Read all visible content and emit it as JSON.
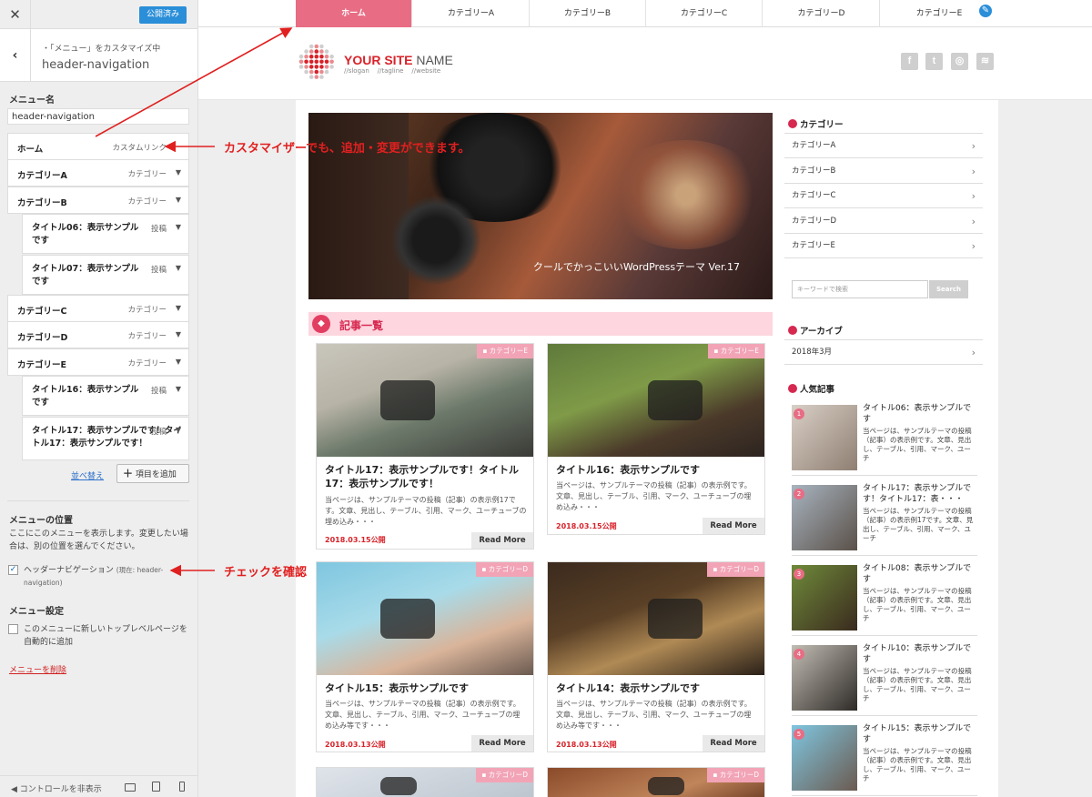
{
  "customizer": {
    "close_icon": "close-icon",
    "publish_label": "公開済み",
    "back_icon": "chevron-left-icon",
    "sub_title": "・「メニュー」をカスタマイズ中",
    "title": "header-navigation",
    "menu_name_label": "メニュー名",
    "menu_name_value": "header-navigation",
    "items": [
      {
        "title": "ホーム",
        "kind": "カスタムリンク",
        "level": 0
      },
      {
        "title": "カテゴリーA",
        "kind": "カテゴリー",
        "level": 0
      },
      {
        "title": "カテゴリーB",
        "kind": "カテゴリー",
        "level": 0
      },
      {
        "title": "タイトル06：表示サンプルです",
        "kind": "投稿",
        "level": 1
      },
      {
        "title": "タイトル07：表示サンプルです",
        "kind": "投稿",
        "level": 1
      },
      {
        "title": "カテゴリーC",
        "kind": "カテゴリー",
        "level": 0
      },
      {
        "title": "カテゴリーD",
        "kind": "カテゴリー",
        "level": 0
      },
      {
        "title": "カテゴリーE",
        "kind": "カテゴリー",
        "level": 0
      },
      {
        "title": "タイトル16：表示サンプルです",
        "kind": "投稿",
        "level": 1
      },
      {
        "title": "タイトル17：表示サンプルです！タイトル17：表示サンプルです！",
        "kind": "投稿",
        "level": 1
      }
    ],
    "reorder_label": "並べ替え",
    "add_items_label": "項目を追加",
    "location_heading": "メニューの位置",
    "location_desc": "ここにこのメニューを表示します。変更したい場合は、別の位置を選んでください。",
    "location_option": "ヘッダーナビゲーション",
    "location_option_note": "(現在: header-navigation)",
    "location_checked": true,
    "settings_heading": "メニュー設定",
    "auto_add_label": "このメニューに新しいトップレベルページを自動的に追加",
    "auto_add_checked": false,
    "delete_label": "メニューを削除",
    "hide_controls_label": "コントロールを非表示"
  },
  "preview": {
    "nav": [
      "ホーム",
      "カテゴリーA",
      "カテゴリーB",
      "カテゴリーC",
      "カテゴリーD",
      "カテゴリーE"
    ],
    "nav_active": 0,
    "site_name_bold": "YOUR SITE",
    "site_name_rest": " NAME",
    "site_tags": "//slogan    //tagline    //website",
    "social_icons": [
      "facebook-icon",
      "twitter-icon",
      "instagram-icon",
      "rss-icon"
    ],
    "hero_caption": "クールでかっこいいWordPressテーマ Ver.17",
    "section_title": "記事一覧",
    "cards": [
      {
        "category": "カテゴリーE",
        "title": "タイトル17：表示サンプルです！タイトル17：表示サンプルです！",
        "excerpt": "当ページは、サンプルテーマの投稿（記事）の表示例17です。文章、見出し、テーブル、引用、マーク、ユーチューブの埋め込み・・・",
        "date": "2018.03.15公開",
        "more": "Read More"
      },
      {
        "category": "カテゴリーE",
        "title": "タイトル16：表示サンプルです",
        "excerpt": "当ページは、サンプルテーマの投稿（記事）の表示例です。文章、見出し、テーブル、引用、マーク、ユーチューブの埋め込み・・・",
        "date": "2018.03.15公開",
        "more": "Read More"
      },
      {
        "category": "カテゴリーD",
        "title": "タイトル15：表示サンプルです",
        "excerpt": "当ページは、サンプルテーマの投稿（記事）の表示例です。文章、見出し、テーブル、引用、マーク、ユーチューブの埋め込み等です・・・",
        "date": "2018.03.13公開",
        "more": "Read More"
      },
      {
        "category": "カテゴリーD",
        "title": "タイトル14：表示サンプルです",
        "excerpt": "当ページは、サンプルテーマの投稿（記事）の表示例です。文章、見出し、テーブル、引用、マーク、ユーチューブの埋め込み等です・・・",
        "date": "2018.03.13公開",
        "more": "Read More"
      },
      {
        "category": "カテゴリーD"
      },
      {
        "category": "カテゴリーD"
      }
    ],
    "sidebar": {
      "categories_heading": "カテゴリー",
      "categories": [
        "カテゴリーA",
        "カテゴリーB",
        "カテゴリーC",
        "カテゴリーD",
        "カテゴリーE"
      ],
      "search_placeholder": "キーワードで検索",
      "search_button": "Search",
      "archive_heading": "アーカイブ",
      "archives": [
        "2018年3月"
      ],
      "popular_heading": "人気記事",
      "popular": [
        {
          "rank": "1",
          "title": "タイトル06：表示サンプルです",
          "excerpt": "当ページは、サンプルテーマの投稿（記事）の表示例です。文章、見出し、テーブル、引用、マーク、ユーチ"
        },
        {
          "rank": "2",
          "title": "タイトル17：表示サンプルです！タイトル17：表・・・",
          "excerpt": "当ページは、サンプルテーマの投稿（記事）の表示例17です。文章、見出し、テーブル、引用、マーク、ユーチ"
        },
        {
          "rank": "3",
          "title": "タイトル08：表示サンプルです",
          "excerpt": "当ページは、サンプルテーマの投稿（記事）の表示例です。文章、見出し、テーブル、引用、マーク、ユーチ"
        },
        {
          "rank": "4",
          "title": "タイトル10：表示サンプルです",
          "excerpt": "当ページは、サンプルテーマの投稿（記事）の表示例です。文章、見出し、テーブル、引用、マーク、ユーチ"
        },
        {
          "rank": "5",
          "title": "タイトル15：表示サンプルです",
          "excerpt": "当ページは、サンプルテーマの投稿（記事）の表示例です。文章、見出し、テーブル、引用、マーク、ユーチ"
        }
      ]
    }
  },
  "annotations": {
    "note_customizer": "カスタマイザーでも、追加・変更ができます。",
    "note_check": "チェックを確認",
    "color": "#e02020"
  },
  "colors": {
    "accent": "#e86d84",
    "brand_red": "#d8232a",
    "publish_blue": "#2a8ed8"
  }
}
